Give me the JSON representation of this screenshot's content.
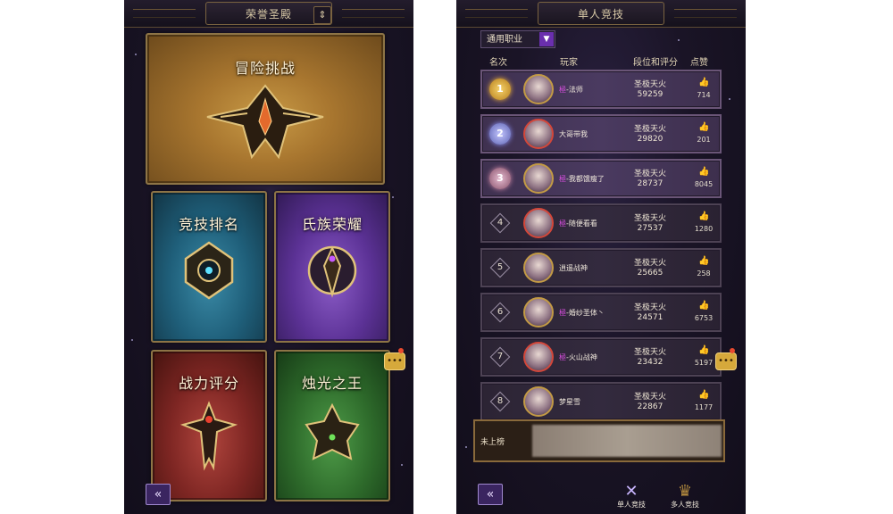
{
  "left_screen": {
    "title": "荣誉圣殿",
    "cards": {
      "adventure": "冒险挑战",
      "arena": "竞技排名",
      "clan": "氏族荣耀",
      "power": "战力评分",
      "king": "烛光之王"
    },
    "back_label": "«"
  },
  "right_screen": {
    "title": "单人竞技",
    "class_filter": "通用职业",
    "columns": {
      "rank": "名次",
      "player": "玩家",
      "tier_score": "段位和评分",
      "likes": "点赞"
    },
    "rows": [
      {
        "rank": "1",
        "prefix": "極",
        "name": "-法师",
        "tier": "圣极天火",
        "score": "59259",
        "likes": "714"
      },
      {
        "rank": "2",
        "prefix": "",
        "name": "大哥带我",
        "tier": "圣极天火",
        "score": "29820",
        "likes": "201"
      },
      {
        "rank": "3",
        "prefix": "極",
        "name": "-我都饿瘦了",
        "tier": "圣极天火",
        "score": "28737",
        "likes": "8045"
      },
      {
        "rank": "4",
        "prefix": "極",
        "name": "-随便看看",
        "tier": "圣极天火",
        "score": "27537",
        "likes": "1280"
      },
      {
        "rank": "5",
        "prefix": "",
        "name": "逍遥战神",
        "tier": "圣极天火",
        "score": "25665",
        "likes": "258"
      },
      {
        "rank": "6",
        "prefix": "極",
        "name": "-婚纱圣体丶",
        "tier": "圣极天火",
        "score": "24571",
        "likes": "6753"
      },
      {
        "rank": "7",
        "prefix": "極",
        "name": "-火山战神",
        "tier": "圣极天火",
        "score": "23432",
        "likes": "5197"
      },
      {
        "rank": "8",
        "prefix": "",
        "name": "梦星雪",
        "tier": "圣极天火",
        "score": "22867",
        "likes": "1177"
      }
    ],
    "unranked_label": "未上榜",
    "tabs": {
      "single": "单人竞技",
      "multi": "多人竞技"
    }
  },
  "colors": {
    "accent_purple": "#6a2fae",
    "gold_border": "#8d7446",
    "background": "#1a1426"
  },
  "icons": {
    "like": "thumbs-up-icon",
    "chat": "chat-bubble-icon",
    "back": "double-chevron-left-icon",
    "swap": "swap-vertical-icon",
    "dropdown": "chevron-down-icon"
  }
}
